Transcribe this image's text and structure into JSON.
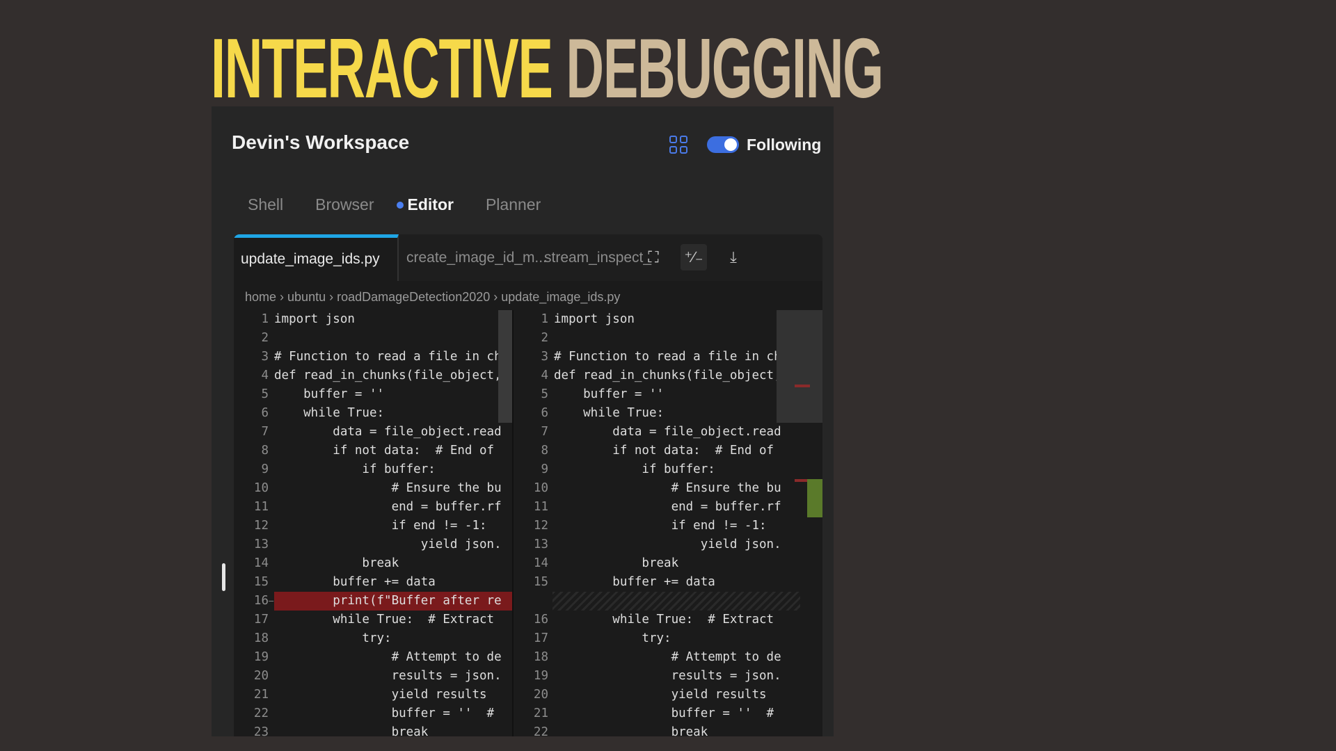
{
  "slide_title": {
    "word1": "INTERACTIVE",
    "word2": "DEBUGGING"
  },
  "workspace": {
    "title": "Devin's Workspace",
    "following_label": "Following",
    "following_on": true
  },
  "tabs": [
    {
      "label": "Shell",
      "active": false
    },
    {
      "label": "Browser",
      "active": false
    },
    {
      "label": "Editor",
      "active": true
    },
    {
      "label": "Planner",
      "active": false
    }
  ],
  "file_tabs": [
    "update_image_ids.py",
    "create_image_id_m...",
    "stream_inspect_"
  ],
  "breadcrumb": [
    "home",
    "ubuntu",
    "roadDamageDetection2020",
    "update_image_ids.py"
  ],
  "left_lines": [
    {
      "n": "1",
      "t": "import json"
    },
    {
      "n": "2",
      "t": ""
    },
    {
      "n": "3",
      "t": "# Function to read a file in ch"
    },
    {
      "n": "4",
      "t": "def read_in_chunks(file_object,"
    },
    {
      "n": "5",
      "t": "    buffer = ''"
    },
    {
      "n": "6",
      "t": "    while True:"
    },
    {
      "n": "7",
      "t": "        data = file_object.read"
    },
    {
      "n": "8",
      "t": "        if not data:  # End of"
    },
    {
      "n": "9",
      "t": "            if buffer:"
    },
    {
      "n": "10",
      "t": "                # Ensure the bu"
    },
    {
      "n": "11",
      "t": "                end = buffer.rf"
    },
    {
      "n": "12",
      "t": "                if end != -1:"
    },
    {
      "n": "13",
      "t": "                    yield json."
    },
    {
      "n": "14",
      "t": "            break"
    },
    {
      "n": "15",
      "t": "        buffer += data"
    },
    {
      "n": "16",
      "t": "        print(f\"Buffer after re",
      "del": true
    },
    {
      "n": "17",
      "t": "        while True:  # Extract"
    },
    {
      "n": "18",
      "t": "            try:"
    },
    {
      "n": "19",
      "t": "                # Attempt to de"
    },
    {
      "n": "20",
      "t": "                results = json."
    },
    {
      "n": "21",
      "t": "                yield results"
    },
    {
      "n": "22",
      "t": "                buffer = ''  #"
    },
    {
      "n": "23",
      "t": "                break"
    }
  ],
  "right_lines": [
    {
      "n": "1",
      "t": "import json"
    },
    {
      "n": "2",
      "t": ""
    },
    {
      "n": "3",
      "t": "# Function to read a file in ch"
    },
    {
      "n": "4",
      "t": "def read_in_chunks(file_object,"
    },
    {
      "n": "5",
      "t": "    buffer = ''"
    },
    {
      "n": "6",
      "t": "    while True:"
    },
    {
      "n": "7",
      "t": "        data = file_object.read"
    },
    {
      "n": "8",
      "t": "        if not data:  # End of"
    },
    {
      "n": "9",
      "t": "            if buffer:"
    },
    {
      "n": "10",
      "t": "                # Ensure the bu"
    },
    {
      "n": "11",
      "t": "                end = buffer.rf"
    },
    {
      "n": "12",
      "t": "                if end != -1:"
    },
    {
      "n": "13",
      "t": "                    yield json."
    },
    {
      "n": "14",
      "t": "            break"
    },
    {
      "n": "15",
      "t": "        buffer += data"
    },
    {
      "n": "",
      "t": "",
      "hatch": true
    },
    {
      "n": "16",
      "t": "        while True:  # Extract"
    },
    {
      "n": "17",
      "t": "            try:"
    },
    {
      "n": "18",
      "t": "                # Attempt to de"
    },
    {
      "n": "19",
      "t": "                results = json."
    },
    {
      "n": "20",
      "t": "                yield results"
    },
    {
      "n": "21",
      "t": "                buffer = ''  #"
    },
    {
      "n": "22",
      "t": "                break"
    }
  ],
  "colors": {
    "accent": "#1fa6e6",
    "toggle": "#3c6ee0",
    "deleted": "#7a1a1c",
    "added_marker": "#5a7a2a",
    "title_yellow": "#f6d94a",
    "title_tan": "#cdb999"
  }
}
